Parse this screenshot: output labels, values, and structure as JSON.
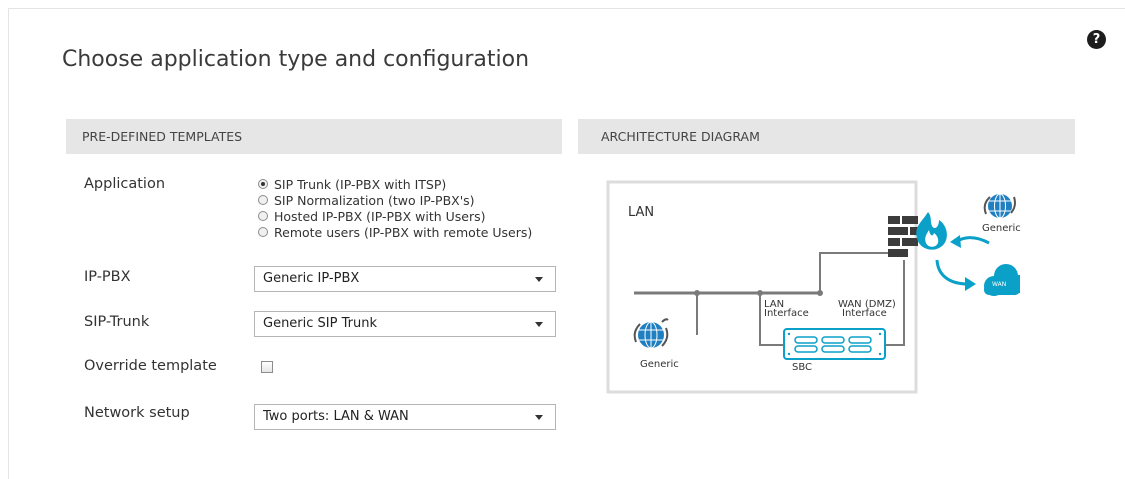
{
  "page": {
    "title": "Choose application type and configuration",
    "help_glyph": "?"
  },
  "templates": {
    "header": "PRE-DEFINED TEMPLATES",
    "application_label": "Application",
    "application_options": [
      {
        "label": "SIP Trunk (IP-PBX with ITSP)",
        "selected": true
      },
      {
        "label": "SIP Normalization (two IP-PBX's)",
        "selected": false
      },
      {
        "label": "Hosted IP-PBX (IP-PBX with Users)",
        "selected": false
      },
      {
        "label": "Remote users (IP-PBX with remote Users)",
        "selected": false
      }
    ],
    "ip_pbx_label": "IP-PBX",
    "ip_pbx_value": "Generic IP-PBX",
    "sip_trunk_label": "SIP-Trunk",
    "sip_trunk_value": "Generic SIP Trunk",
    "override_label": "Override template",
    "override_checked": false,
    "network_label": "Network setup",
    "network_value": "Two ports: LAN & WAN"
  },
  "architecture": {
    "header": "ARCHITECTURE DIAGRAM",
    "lan_label": "LAN",
    "lan_interface_label": [
      "LAN",
      "Interface"
    ],
    "wan_interface_label": [
      "WAN (DMZ)",
      "Interface"
    ],
    "sbc_label": "SBC",
    "generic_left_label": "Generic",
    "generic_right_label": "Generic",
    "wan_cloud_label": "WAN",
    "colors": {
      "accent": "#0aa0c8",
      "globe": "#1f7fc0",
      "line": "#7a7a7a",
      "firewall": "#3c3c3c",
      "frame": "#dcdcdc"
    }
  }
}
